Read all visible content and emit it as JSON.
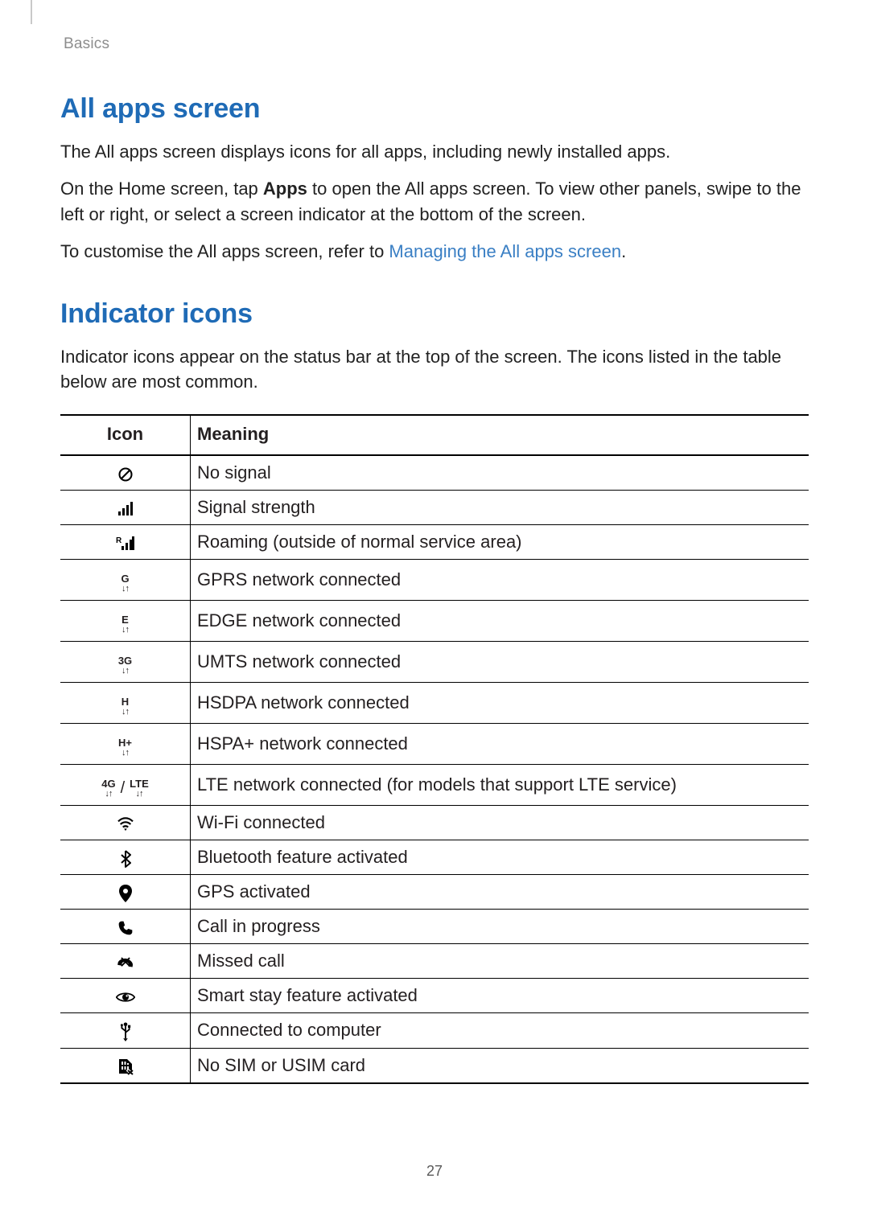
{
  "breadcrumb": "Basics",
  "section1": {
    "title": "All apps screen",
    "p1": "The All apps screen displays icons for all apps, including newly installed apps.",
    "p2_a": "On the Home screen, tap ",
    "p2_bold": "Apps",
    "p2_b": " to open the All apps screen. To view other panels, swipe to the left or right, or select a screen indicator at the bottom of the screen.",
    "p3_a": "To customise the All apps screen, refer to ",
    "p3_link": "Managing the All apps screen",
    "p3_b": "."
  },
  "section2": {
    "title": "Indicator icons",
    "intro": "Indicator icons appear on the status bar at the top of the screen. The icons listed in the table below are most common.",
    "headers": {
      "icon": "Icon",
      "meaning": "Meaning"
    },
    "rows": [
      {
        "icon": "no-signal",
        "meaning": "No signal"
      },
      {
        "icon": "signal-bars",
        "meaning": "Signal strength"
      },
      {
        "icon": "roaming",
        "meaning": "Roaming (outside of normal service area)"
      },
      {
        "icon": "net-g",
        "label": "G",
        "meaning": "GPRS network connected"
      },
      {
        "icon": "net-e",
        "label": "E",
        "meaning": "EDGE network connected"
      },
      {
        "icon": "net-3g",
        "label": "3G",
        "meaning": "UMTS network connected"
      },
      {
        "icon": "net-h",
        "label": "H",
        "meaning": "HSDPA network connected"
      },
      {
        "icon": "net-hplus",
        "label": "H+",
        "meaning": "HSPA+ network connected"
      },
      {
        "icon": "net-4g-lte",
        "label_a": "4G",
        "label_b": "LTE",
        "meaning": "LTE network connected (for models that support LTE service)"
      },
      {
        "icon": "wifi",
        "meaning": "Wi-Fi connected"
      },
      {
        "icon": "bluetooth",
        "meaning": "Bluetooth feature activated"
      },
      {
        "icon": "gps",
        "meaning": "GPS activated"
      },
      {
        "icon": "call",
        "meaning": "Call in progress"
      },
      {
        "icon": "missed-call",
        "meaning": "Missed call"
      },
      {
        "icon": "smart-stay",
        "meaning": "Smart stay feature activated"
      },
      {
        "icon": "usb",
        "meaning": "Connected to computer"
      },
      {
        "icon": "no-sim",
        "meaning": "No SIM or USIM card"
      }
    ]
  },
  "page_number": "27"
}
